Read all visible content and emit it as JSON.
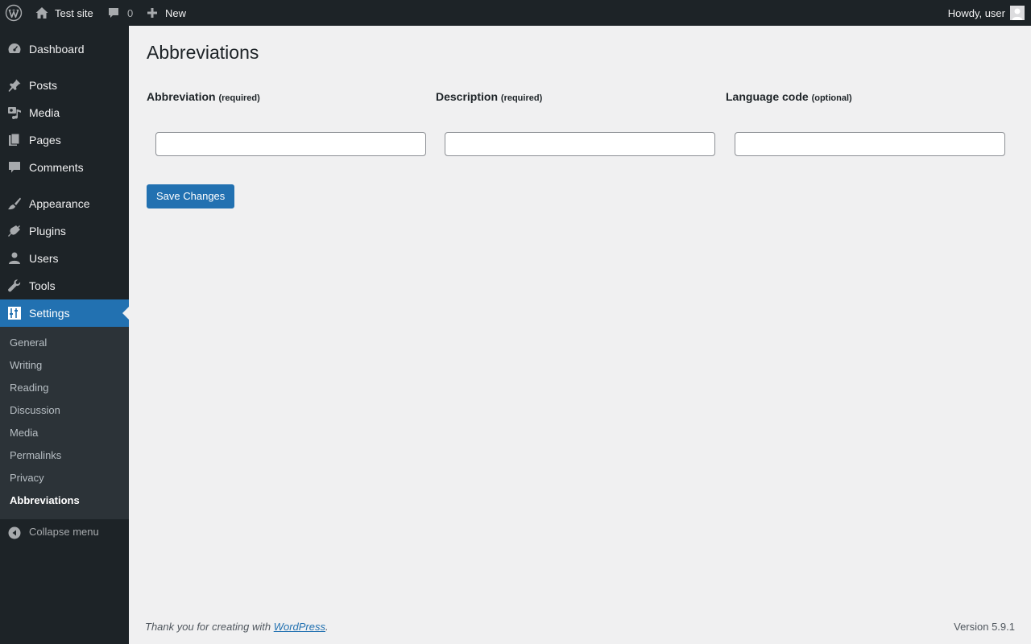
{
  "adminbar": {
    "wp_logo_icon": "wordpress-logo-icon",
    "site_name": "Test site",
    "comments_count": "0",
    "new_label": "New",
    "howdy": "Howdy, user"
  },
  "sidebar": {
    "items": [
      {
        "label": "Dashboard",
        "icon": "dashboard-icon"
      },
      {
        "label": "Posts",
        "icon": "pin-icon"
      },
      {
        "label": "Media",
        "icon": "media-icon"
      },
      {
        "label": "Pages",
        "icon": "pages-icon"
      },
      {
        "label": "Comments",
        "icon": "comment-icon"
      },
      {
        "label": "Appearance",
        "icon": "brush-icon"
      },
      {
        "label": "Plugins",
        "icon": "plug-icon"
      },
      {
        "label": "Users",
        "icon": "user-icon"
      },
      {
        "label": "Tools",
        "icon": "wrench-icon"
      },
      {
        "label": "Settings",
        "icon": "sliders-icon",
        "current": true
      }
    ],
    "submenu": [
      "General",
      "Writing",
      "Reading",
      "Discussion",
      "Media",
      "Permalinks",
      "Privacy",
      "Abbreviations"
    ],
    "submenu_current": "Abbreviations",
    "collapse_label": "Collapse menu"
  },
  "main": {
    "title": "Abbreviations",
    "columns": [
      {
        "label": "Abbreviation",
        "note": "(required)",
        "value": ""
      },
      {
        "label": "Description",
        "note": "(required)",
        "value": ""
      },
      {
        "label": "Language code",
        "note": "(optional)",
        "value": ""
      }
    ],
    "save_label": "Save Changes"
  },
  "footer": {
    "thanks_prefix": "Thank you for creating with ",
    "thanks_link": "WordPress",
    "thanks_suffix": ".",
    "version": "Version 5.9.1"
  },
  "colors": {
    "adminbar_bg": "#1d2327",
    "accent": "#2271b1",
    "content_bg": "#f0f0f1",
    "submenu_bg": "#2c3338"
  }
}
